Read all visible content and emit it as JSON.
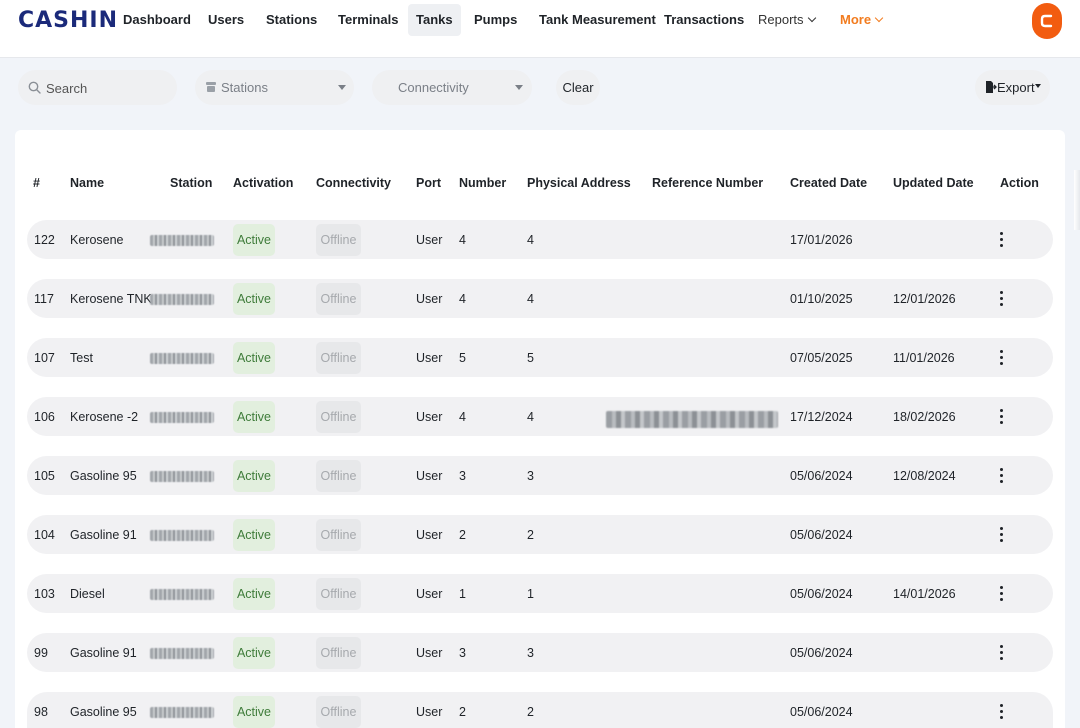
{
  "brand": {
    "logo_text": "CASHIN",
    "accent_color": "#f27c1f",
    "logo_color": "#1b2a7a"
  },
  "nav": {
    "items": [
      {
        "label": "Dashboard"
      },
      {
        "label": "Users"
      },
      {
        "label": "Stations"
      },
      {
        "label": "Terminals"
      },
      {
        "label": "Tanks",
        "active": true
      },
      {
        "label": "Pumps"
      },
      {
        "label": "Tank Measurement"
      },
      {
        "label": "Transactions"
      }
    ],
    "reports_label": "Reports",
    "more_label": "More"
  },
  "filters": {
    "search_placeholder": "Search",
    "stations_placeholder": "Stations",
    "connectivity_placeholder": "Connectivity",
    "clear_label": "Clear",
    "export_label": "Export"
  },
  "table": {
    "columns": [
      "#",
      "Name",
      "Station",
      "Activation",
      "Connectivity",
      "Port",
      "Number",
      "Physical Address",
      "Reference Number",
      "Created Date",
      "Updated Date",
      "Action"
    ],
    "rows": [
      {
        "id": "122",
        "name": "Kerosene",
        "activation": "Active",
        "connectivity": "Offline",
        "port": "User",
        "number": "4",
        "physical_address": "4",
        "reference_redacted": false,
        "created": "17/01/2026",
        "updated": ""
      },
      {
        "id": "117",
        "name": "Kerosene TNK",
        "activation": "Active",
        "connectivity": "Offline",
        "port": "User",
        "number": "4",
        "physical_address": "4",
        "reference_redacted": false,
        "created": "01/10/2025",
        "updated": "12/01/2026"
      },
      {
        "id": "107",
        "name": "Test",
        "activation": "Active",
        "connectivity": "Offline",
        "port": "User",
        "number": "5",
        "physical_address": "5",
        "reference_redacted": false,
        "created": "07/05/2025",
        "updated": "11/01/2026"
      },
      {
        "id": "106",
        "name": "Kerosene -2",
        "activation": "Active",
        "connectivity": "Offline",
        "port": "User",
        "number": "4",
        "physical_address": "4",
        "reference_redacted": true,
        "created": "17/12/2024",
        "updated": "18/02/2026"
      },
      {
        "id": "105",
        "name": "Gasoline 95",
        "activation": "Active",
        "connectivity": "Offline",
        "port": "User",
        "number": "3",
        "physical_address": "3",
        "reference_redacted": false,
        "created": "05/06/2024",
        "updated": "12/08/2024"
      },
      {
        "id": "104",
        "name": "Gasoline 91",
        "activation": "Active",
        "connectivity": "Offline",
        "port": "User",
        "number": "2",
        "physical_address": "2",
        "reference_redacted": false,
        "created": "05/06/2024",
        "updated": ""
      },
      {
        "id": "103",
        "name": "Diesel",
        "activation": "Active",
        "connectivity": "Offline",
        "port": "User",
        "number": "1",
        "physical_address": "1",
        "reference_redacted": false,
        "created": "05/06/2024",
        "updated": "14/01/2026"
      },
      {
        "id": "99",
        "name": "Gasoline 91",
        "activation": "Active",
        "connectivity": "Offline",
        "port": "User",
        "number": "3",
        "physical_address": "3",
        "reference_redacted": false,
        "created": "05/06/2024",
        "updated": ""
      },
      {
        "id": "98",
        "name": "Gasoline 95",
        "activation": "Active",
        "connectivity": "Offline",
        "port": "User",
        "number": "2",
        "physical_address": "2",
        "reference_redacted": false,
        "created": "05/06/2024",
        "updated": ""
      }
    ]
  }
}
